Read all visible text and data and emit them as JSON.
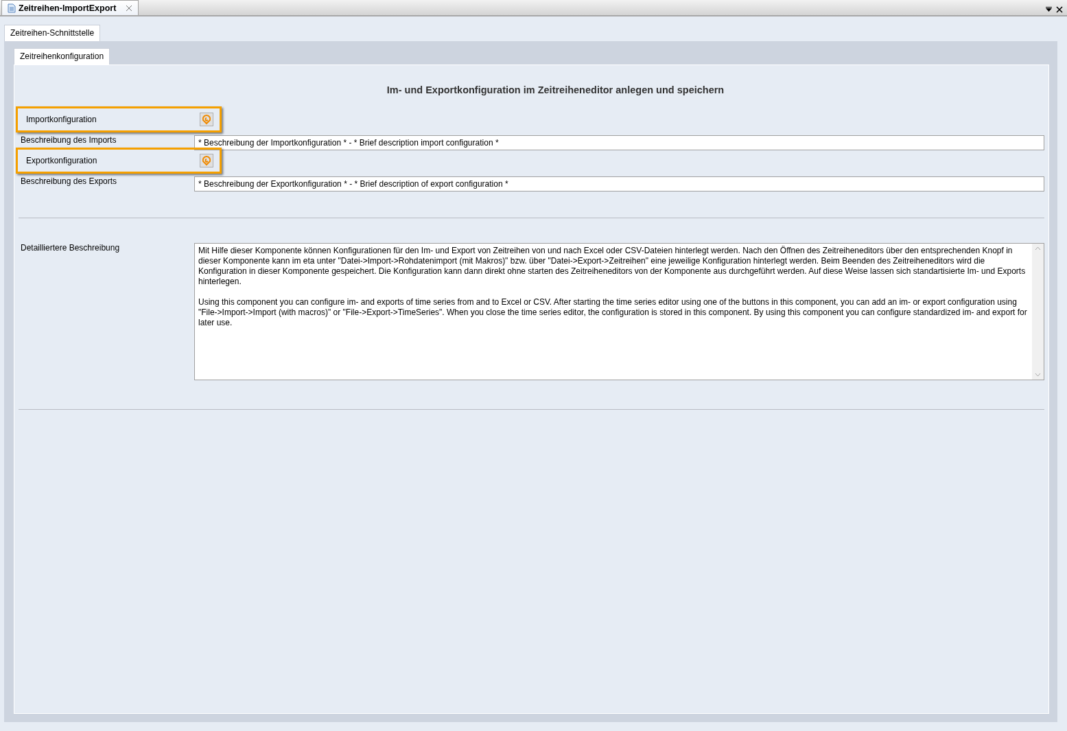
{
  "document_tab": {
    "title": "Zeitreihen-ImportExport"
  },
  "outer_tabs": [
    {
      "label": "Zeitreihen-Schnittstelle",
      "selected": true
    }
  ],
  "inner_tabs": [
    {
      "label": "Zeitreihenkonfiguration",
      "selected": true
    }
  ],
  "heading": "Im- und Exportkonfiguration im Zeitreiheneditor anlegen und speichern",
  "rows": [
    {
      "kind": "config",
      "label": "Importkonfiguration",
      "highlighted": true
    },
    {
      "kind": "field",
      "label": "Beschreibung des Imports",
      "value": "* Beschreibung der Importkonfiguration * - * Brief description import configuration *"
    },
    {
      "kind": "config",
      "label": "Exportkonfiguration",
      "highlighted": true
    },
    {
      "kind": "field",
      "label": "Beschreibung des Exports",
      "value": "* Beschreibung der Exportkonfiguration * - * Brief description of export configuration *"
    }
  ],
  "detail": {
    "label": "Detailliertere Beschreibung",
    "paragraphs": [
      "Mit Hilfe dieser Komponente können Konfigurationen für den Im- und Export von Zeitreihen von und nach Excel oder CSV-Dateien hinterlegt werden. Nach den Öffnen des Zeitreiheneditors über den entsprechenden Knopf in dieser Komponente kann im eta unter \"Datei->Import->Rohdatenimport (mit Makros)\" bzw. über \"Datei->Export->Zeitreihen\" eine jeweilige Konfiguration hinterlegt werden. Beim Beenden des Zeitreiheneditors wird die Konfiguration in dieser Komponente gespeichert. Die Konfiguration kann dann direkt ohne starten des Zeitreiheneditors von der Komponente aus durchgeführt werden. Auf diese Weise lassen sich standartisierte Im- und Exports hinterlegen.",
      "Using this component you can configure im- and exports of time series from and to Excel or CSV. After starting the time series editor using one of the buttons in this component, you can add an im- or export configuration using \"File->Import->Import (with macros)\" or \"File->Export->TimeSeries\". When you close the time series editor, the configuration is stored in this component. By using this component you can configure standardized im- and export for later use."
    ]
  }
}
